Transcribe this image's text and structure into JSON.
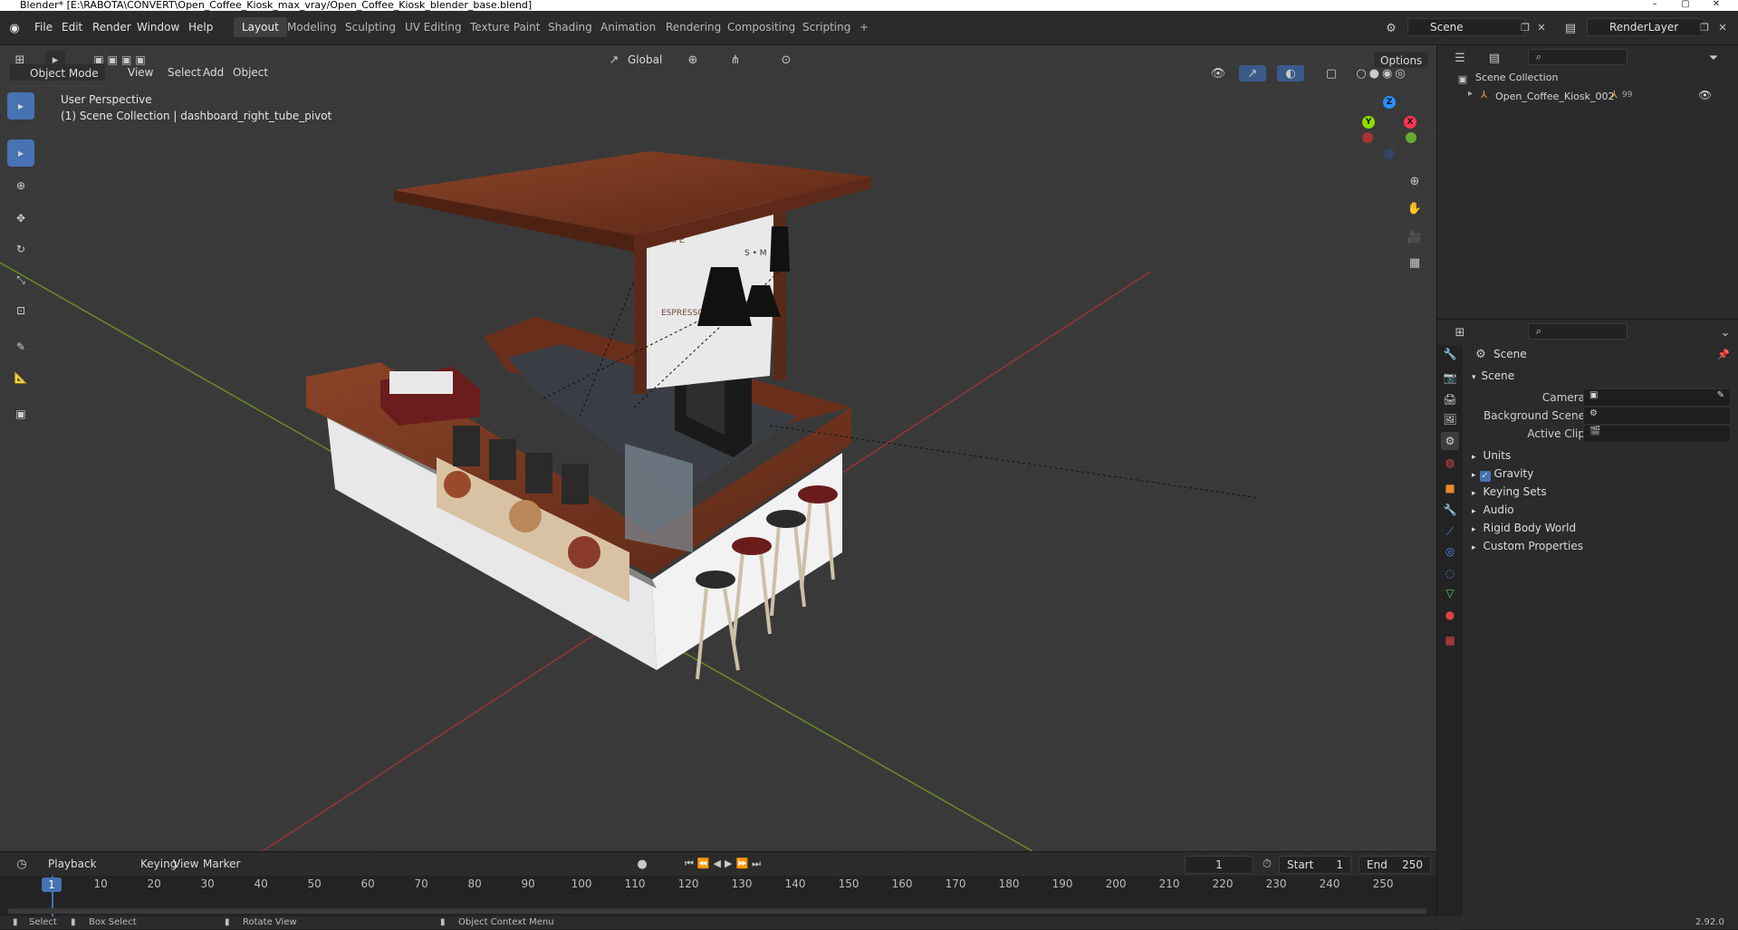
{
  "title": "Blender* [E:\\RABOTA\\CONVERT\\Open_Coffee_Kiosk_max_vray/Open_Coffee_Kiosk_blender_base.blend]",
  "menus": [
    "File",
    "Edit",
    "Render",
    "Window",
    "Help"
  ],
  "workspaces": [
    "Layout",
    "Modeling",
    "Sculpting",
    "UV Editing",
    "Texture Paint",
    "Shading",
    "Animation",
    "Rendering",
    "Compositing",
    "Scripting"
  ],
  "workspace_add": "+",
  "scene_field": "Scene",
  "renderlayer_field": "RenderLayer",
  "header": {
    "transform_orientation": "Global",
    "options": "Options"
  },
  "viewport": {
    "mode": "Object Mode",
    "view": "View",
    "select": "Select",
    "add": "Add",
    "object": "Object",
    "perspective": "User Perspective",
    "context": "(1) Scene Collection | dashboard_right_tube_pivot",
    "gizmo": {
      "z": "Z",
      "y": "Y",
      "x": "X"
    }
  },
  "scene_text": {
    "cafe": "CAFE",
    "espresso": "ESPRESSO",
    "sizes": "S • M"
  },
  "outliner": {
    "root": "Scene Collection",
    "item": "Open_Coffee_Kiosk_002",
    "badge": "99"
  },
  "properties": {
    "header": "Scene",
    "panel": "Scene",
    "camera_label": "Camera",
    "bg_label": "Background Scene",
    "clip_label": "Active Clip",
    "sections": [
      "Units",
      "Gravity",
      "Keying Sets",
      "Audio",
      "Rigid Body World",
      "Custom Properties"
    ]
  },
  "timeline": {
    "playback": "Playback",
    "keying": "Keying",
    "view": "View",
    "marker": "Marker",
    "current_frame": "1",
    "start_label": "Start",
    "start": "1",
    "end_label": "End",
    "end": "250",
    "ticks": [
      "1",
      "10",
      "20",
      "30",
      "40",
      "50",
      "60",
      "70",
      "80",
      "90",
      "100",
      "110",
      "120",
      "130",
      "140",
      "150",
      "160",
      "170",
      "180",
      "190",
      "200",
      "210",
      "220",
      "230",
      "240",
      "250"
    ]
  },
  "status": {
    "select": "Select",
    "box_select": "Box Select",
    "rotate": "Rotate View",
    "context_menu": "Object Context Menu",
    "version": "2.92.0"
  },
  "colors": {
    "accent": "#4772b3",
    "x_axis": "#ff3352",
    "y_axis": "#8bdc00",
    "z_axis": "#2890ff",
    "wood": "#7a3a22"
  }
}
